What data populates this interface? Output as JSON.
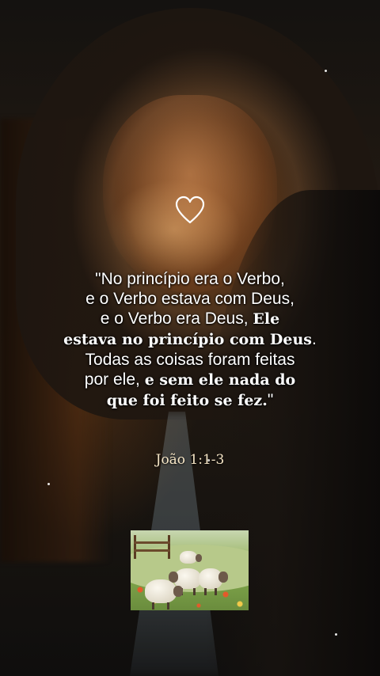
{
  "icons": {
    "heart": "heart-outline-icon"
  },
  "quote": {
    "l1": "\"No princípio era o Verbo,",
    "l2": "e o Verbo estava com Deus,",
    "l3_normal": "e o Verbo era Deus, ",
    "l3_bold": "Ele",
    "l4_bold": "estava no princípio com Deus",
    "l4_normal": ".",
    "l5": "Todas as coisas foram feitas",
    "l6_normal": "por ele, ",
    "l6_bold": "e sem ele nada do",
    "l7_bold": "que foi feito se fez.",
    "l7_normal": "\""
  },
  "reference": "João 1:1-3",
  "colors": {
    "text": "#ffffff",
    "reference": "#f6e6c6",
    "background": "#0c0b0a"
  }
}
